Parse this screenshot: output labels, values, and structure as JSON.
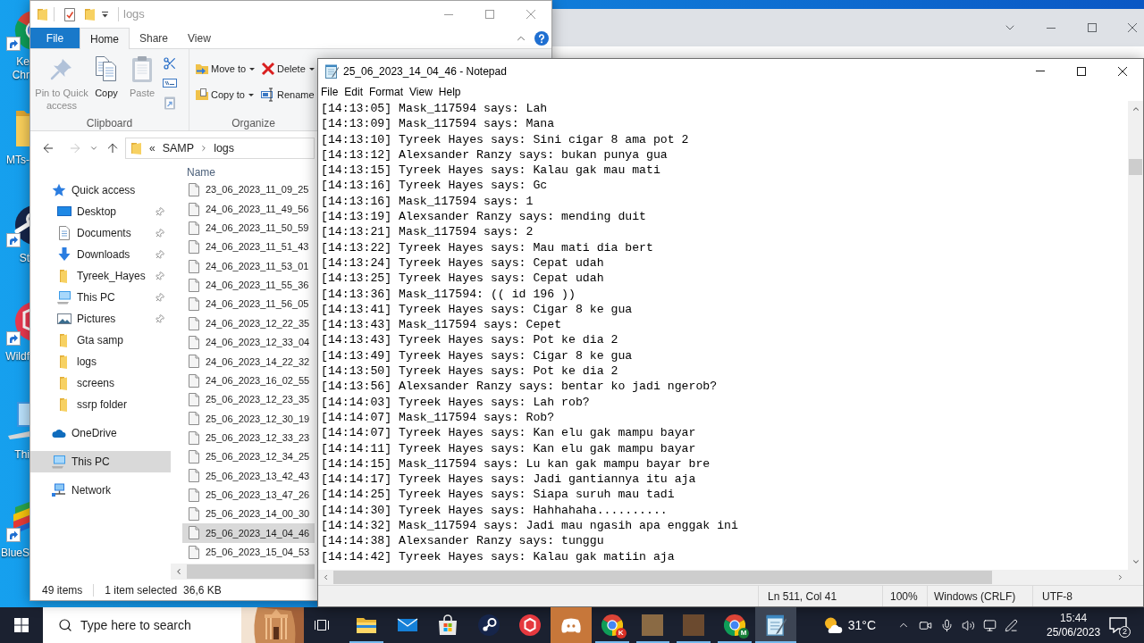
{
  "desktop": {
    "icons": [
      {
        "kind": "browser",
        "label": "Ke Chr"
      },
      {
        "kind": "folder",
        "label": "MTs-"
      },
      {
        "kind": "disc",
        "label": "St"
      },
      {
        "kind": "hexagon",
        "label": "Wildf"
      },
      {
        "kind": "computer",
        "label": "Thi"
      },
      {
        "kind": "layers",
        "label": "BlueS"
      }
    ]
  },
  "explorer": {
    "active": false,
    "title": "logs",
    "file_tab": "File",
    "tabs": [
      {
        "label": "Home",
        "selected": true
      },
      {
        "label": "Share",
        "selected": false
      },
      {
        "label": "View",
        "selected": false
      }
    ],
    "ribbon": {
      "groups": [
        {
          "label": "Clipboard",
          "buttons": [
            {
              "kind": "pin",
              "label": "Pin to Quick access",
              "disabled": true,
              "dropdown": false
            },
            {
              "kind": "copy",
              "label": "Copy",
              "disabled": false,
              "dropdown": false
            },
            {
              "kind": "paste",
              "label": "Paste",
              "disabled": true,
              "dropdown": false
            }
          ]
        },
        {
          "label": "Organize",
          "buttons": [
            {
              "kind": "move",
              "label": "Move to",
              "disabled": false,
              "dropdown": true
            },
            {
              "kind": "copyto",
              "label": "Copy to",
              "disabled": false,
              "dropdown": true
            },
            {
              "kind": "delete",
              "label": "Delete",
              "disabled": false,
              "dropdown": true
            },
            {
              "kind": "rename",
              "label": "Rename",
              "disabled": false,
              "dropdown": false
            }
          ]
        }
      ]
    },
    "address": {
      "back_disabled": false,
      "forward_disabled": true,
      "overflow_mark": "«",
      "path": [
        "SAMP",
        "logs"
      ]
    },
    "navigation": [
      {
        "kind": "star",
        "label": "Quick access",
        "selected": false,
        "pinned": false,
        "children": [
          {
            "kind": "desktop",
            "label": "Desktop",
            "selected": false,
            "pinned": true
          },
          {
            "kind": "documents",
            "label": "Documents",
            "selected": false,
            "pinned": true
          },
          {
            "kind": "downloads",
            "label": "Downloads",
            "selected": false,
            "pinned": true
          },
          {
            "kind": "folder",
            "label": "Tyreek_Hayes",
            "selected": false,
            "pinned": true
          },
          {
            "kind": "computer",
            "label": "This PC",
            "selected": false,
            "pinned": true
          },
          {
            "kind": "pictures",
            "label": "Pictures",
            "selected": false,
            "pinned": true
          },
          {
            "kind": "folder",
            "label": "Gta samp",
            "selected": false,
            "pinned": false
          },
          {
            "kind": "folder",
            "label": "logs",
            "selected": false,
            "pinned": false
          },
          {
            "kind": "folder",
            "label": "screens",
            "selected": false,
            "pinned": false
          },
          {
            "kind": "folder",
            "label": "ssrp folder",
            "selected": false,
            "pinned": false
          }
        ]
      },
      {
        "kind": "cloud",
        "label": "OneDrive",
        "selected": false,
        "pinned": false
      },
      {
        "kind": "computer",
        "label": "This PC",
        "selected": true,
        "pinned": false
      },
      {
        "kind": "network",
        "label": "Network",
        "selected": false,
        "pinned": false
      }
    ],
    "columns": [
      "Name"
    ],
    "files": [
      {
        "name": "23_06_2023_11_09_25",
        "selected": false
      },
      {
        "name": "24_06_2023_11_49_56",
        "selected": false
      },
      {
        "name": "24_06_2023_11_50_59",
        "selected": false
      },
      {
        "name": "24_06_2023_11_51_43",
        "selected": false
      },
      {
        "name": "24_06_2023_11_53_01",
        "selected": false
      },
      {
        "name": "24_06_2023_11_55_36",
        "selected": false
      },
      {
        "name": "24_06_2023_11_56_05",
        "selected": false
      },
      {
        "name": "24_06_2023_12_22_35",
        "selected": false
      },
      {
        "name": "24_06_2023_12_33_04",
        "selected": false
      },
      {
        "name": "24_06_2023_14_22_32",
        "selected": false
      },
      {
        "name": "24_06_2023_16_02_55",
        "selected": false
      },
      {
        "name": "25_06_2023_12_23_35",
        "selected": false
      },
      {
        "name": "25_06_2023_12_30_19",
        "selected": false
      },
      {
        "name": "25_06_2023_12_33_23",
        "selected": false
      },
      {
        "name": "25_06_2023_12_34_25",
        "selected": false
      },
      {
        "name": "25_06_2023_13_42_43",
        "selected": false
      },
      {
        "name": "25_06_2023_13_47_26",
        "selected": false
      },
      {
        "name": "25_06_2023_14_00_30",
        "selected": false
      },
      {
        "name": "25_06_2023_14_04_46",
        "selected": true
      },
      {
        "name": "25_06_2023_15_04_53",
        "selected": false
      }
    ],
    "status": {
      "count": "49 items",
      "selection": "1 item selected",
      "size": "36,6 KB"
    }
  },
  "notepad": {
    "active": true,
    "title": "25_06_2023_14_04_46 - Notepad",
    "menu": [
      "File",
      "Edit",
      "Format",
      "View",
      "Help"
    ],
    "lines": [
      "[14:13:05] Mask_117594 says: Lah",
      "[14:13:09] Mask_117594 says: Mana",
      "[14:13:10] Tyreek Hayes says: Sini cigar 8 ama pot 2",
      "[14:13:12] Alexsander Ranzy says: bukan punya gua",
      "[14:13:15] Tyreek Hayes says: Kalau gak mau mati",
      "[14:13:16] Tyreek Hayes says: Gc",
      "[14:13:16] Mask_117594 says: 1",
      "[14:13:19] Alexsander Ranzy says: mending duit",
      "[14:13:21] Mask_117594 says: 2",
      "[14:13:22] Tyreek Hayes says: Mau mati dia bert",
      "[14:13:24] Tyreek Hayes says: Cepat udah",
      "[14:13:25] Tyreek Hayes says: Cepat udah",
      "[14:13:36] Mask_117594: (( id 196 ))",
      "[14:13:41] Tyreek Hayes says: Cigar 8 ke gua",
      "[14:13:43] Mask_117594 says: Cepet",
      "[14:13:43] Tyreek Hayes says: Pot ke dia 2",
      "[14:13:49] Tyreek Hayes says: Cigar 8 ke gua",
      "[14:13:50] Tyreek Hayes says: Pot ke dia 2",
      "[14:13:56] Alexsander Ranzy says: bentar ko jadi ngerob?",
      "[14:14:03] Tyreek Hayes says: Lah rob?",
      "[14:14:07] Mask_117594 says: Rob?",
      "[14:14:07] Tyreek Hayes says: Kan elu gak mampu bayar",
      "[14:14:11] Tyreek Hayes says: Kan elu gak mampu bayar",
      "[14:14:15] Mask_117594 says: Lu kan gak mampu bayar bre",
      "[14:14:17] Tyreek Hayes says: Jadi gantiannya itu aja",
      "[14:14:25] Tyreek Hayes says: Siapa suruh mau tadi",
      "[14:14:30] Tyreek Hayes says: Hahhahaha..........",
      "[14:14:32] Mask_117594 says: Jadi mau ngasih apa enggak ini",
      "[14:14:38] Alexsander Ranzy says: tunggu",
      "[14:14:42] Tyreek Hayes says: Kalau gak matiin aja"
    ],
    "status": {
      "position": "Ln 511, Col 41",
      "zoom": "100%",
      "line_endings": "Windows (CRLF)",
      "encoding": "UTF-8"
    }
  },
  "taskbar": {
    "search_placeholder": "Type here to search",
    "apps": [
      {
        "kind": "folder",
        "running": true,
        "active": false,
        "flashing": false
      },
      {
        "kind": "mail",
        "running": false,
        "active": false,
        "flashing": false
      },
      {
        "kind": "store",
        "running": false,
        "active": false,
        "flashing": false
      },
      {
        "kind": "disc",
        "running": false,
        "active": false,
        "flashing": false
      },
      {
        "kind": "hexagon",
        "running": false,
        "active": false,
        "flashing": false
      },
      {
        "kind": "controller",
        "running": false,
        "active": false,
        "flashing": true
      },
      {
        "kind": "browser",
        "running": true,
        "active": false,
        "flashing": false,
        "badge": {
          "text": "K",
          "color": "#d93025"
        }
      },
      {
        "kind": "thumbnail",
        "running": true,
        "active": false,
        "flashing": false
      },
      {
        "kind": "thumbnail",
        "running": true,
        "active": false,
        "flashing": false
      },
      {
        "kind": "browser",
        "running": true,
        "active": false,
        "flashing": false,
        "badge": {
          "text": "M",
          "color": "#188038"
        }
      },
      {
        "kind": "notepad",
        "running": true,
        "active": true,
        "flashing": false
      }
    ],
    "weather": "31°C",
    "time": "15:44",
    "date": "25/06/2023",
    "notifications": "2"
  }
}
